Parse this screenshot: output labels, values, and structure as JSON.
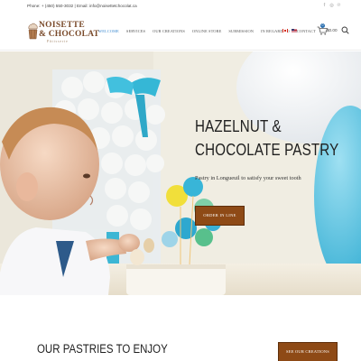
{
  "topbar": {
    "contact": "Phone: + (450) 550-3032 | Email: info@noisettetchocolat.ca",
    "social_icons": [
      "facebook-icon",
      "instagram-icon",
      "pinterest-icon"
    ]
  },
  "header": {
    "logo": {
      "line1": "NOISETTE",
      "line2": "& CHOCOLAT",
      "tagline": "Pâtisserie"
    },
    "nav": [
      {
        "label": "WELCOME",
        "active": true
      },
      {
        "label": "SERVICES",
        "active": false
      },
      {
        "label": "OUR CREATIONS",
        "active": false
      },
      {
        "label": "ONLINE STORE",
        "active": false
      },
      {
        "label": "SUBMISSION",
        "active": false
      },
      {
        "label": "IN REGARD TO",
        "active": false
      },
      {
        "label": "CONTACT",
        "active": false
      }
    ],
    "languages": [
      "flag-canada-icon",
      "flag-usa-icon"
    ],
    "cart": {
      "count": "0",
      "total": "$0.00"
    }
  },
  "hero": {
    "title_line1": "HAZELNUT &",
    "title_line2": "CHOCOLATE PASTRY",
    "subtitle": "Pastry in Longueuil to satisfy your sweet tooth",
    "button_label": "ORDER IN LINE"
  },
  "section": {
    "title": "OUR PASTRIES TO ENJOY",
    "button_label": "SEE OUR CREATIONS"
  },
  "colors": {
    "accent_brown": "#8e4a16",
    "nav_active": "#3d8ad0",
    "logo_brown": "#7a4a2a"
  }
}
